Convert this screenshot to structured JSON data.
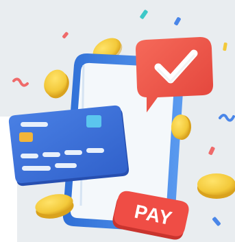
{
  "illustration": {
    "pay_label": "PAY",
    "icons": [
      "smartphone-icon",
      "credit-card-icon",
      "checkmark-bubble-icon",
      "coin-icon",
      "confetti-icon"
    ],
    "colors": {
      "background_panel": "#e9edf0",
      "phone_frame": "#3b7de0",
      "phone_screen": "#f4f8fb",
      "card_blue": "#3d6fd8",
      "card_chip": "#f2b53a",
      "card_accent": "#5bc6ee",
      "bubble_red": "#f0574a",
      "pay_badge_red": "#ef4d45",
      "coin_gold": "#f3c93a",
      "confetti_teal": "#3dc8c8",
      "confetti_pink": "#ef6a6a",
      "confetti_blue": "#4a86e8"
    }
  }
}
